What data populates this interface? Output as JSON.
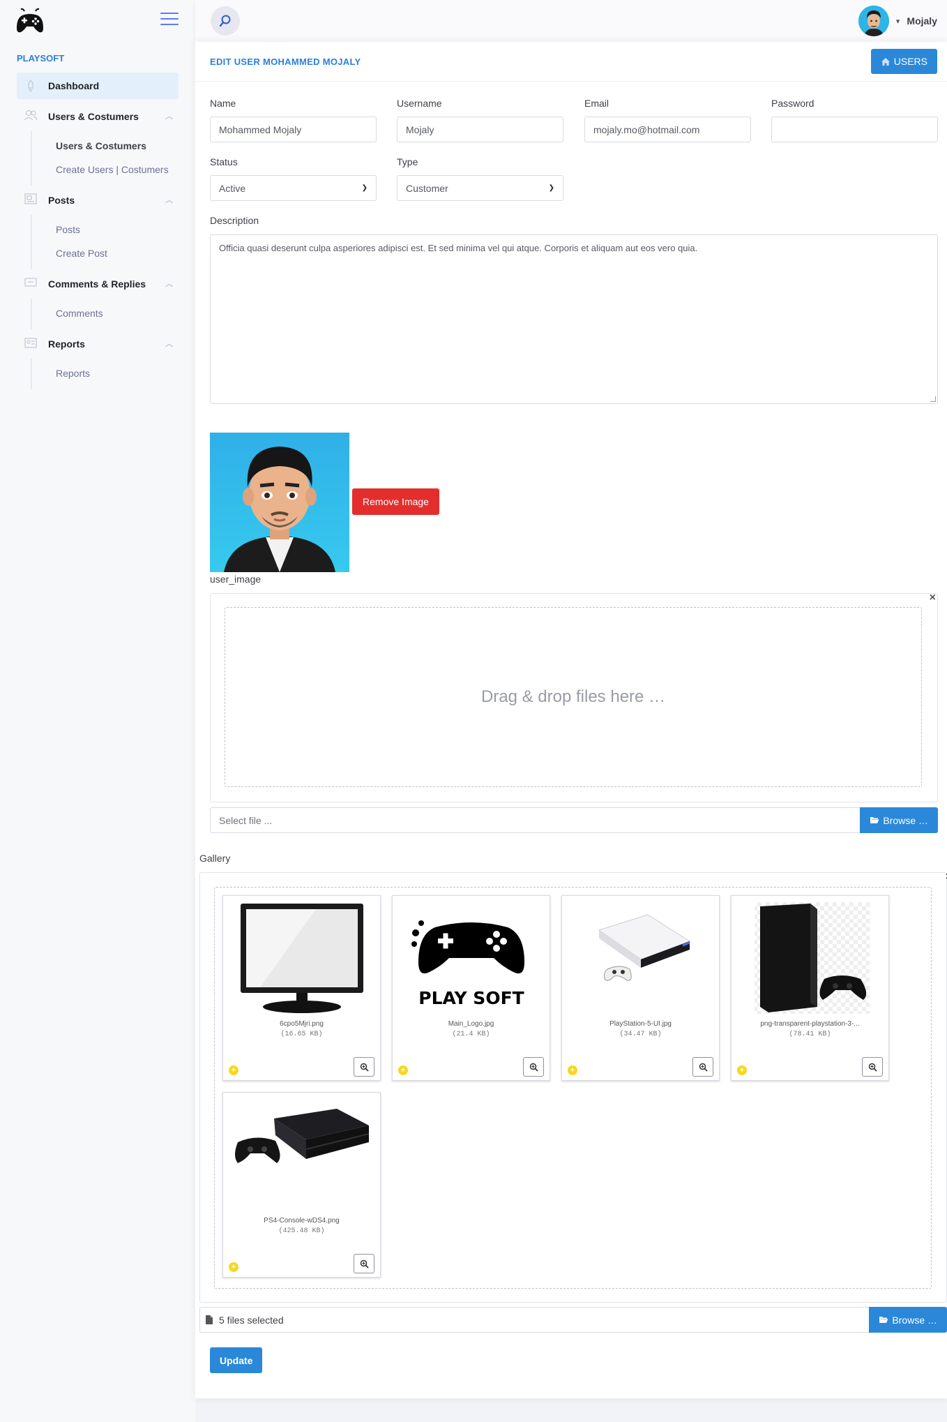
{
  "brand": "PLAYSOFT",
  "sidebar": {
    "items": [
      {
        "label": "Dashboard"
      },
      {
        "label": "Users & Costumers",
        "sub": [
          "Users & Costumers",
          "Create Users | Costumers"
        ]
      },
      {
        "label": "Posts",
        "sub": [
          "Posts",
          "Create Post"
        ]
      },
      {
        "label": "Comments & Replies",
        "sub": [
          "Comments"
        ]
      },
      {
        "label": "Reports",
        "sub": [
          "Reports"
        ]
      }
    ]
  },
  "topbar": {
    "user_name": "Mojaly"
  },
  "page": {
    "title": "EDIT USER MOHAMMED MOJALY",
    "users_button": "USERS",
    "labels": {
      "name": "Name",
      "username": "Username",
      "email": "Email",
      "password": "Password",
      "status": "Status",
      "type": "Type",
      "description": "Description"
    },
    "fields": {
      "name": "Mohammed Mojaly",
      "username": "Mojaly",
      "email": "mojaly.mo@hotmail.com",
      "password": "",
      "status": "Active",
      "type": "Customer",
      "description": "Officia quasi deserunt culpa asperiores adipisci est. Et sed minima vel qui atque. Corporis et aliquam aut eos vero quia."
    },
    "remove_image": "Remove Image",
    "image_label": "user_image",
    "drop_text": "Drag & drop files here …",
    "select_file_placeholder": "Select file ...",
    "browse": "Browse …",
    "gallery_label": "Gallery",
    "gallery_files": [
      {
        "name": "6cpo5Mjri.png",
        "size": "(16.65 KB)"
      },
      {
        "name": "Main_Logo.jpg",
        "size": "(21.4 KB)"
      },
      {
        "name": "PlayStation-5-UI.jpg",
        "size": "(34.47 KB)"
      },
      {
        "name": "png-transparent-playstation-3-...",
        "size": "(78.41 KB)"
      },
      {
        "name": "PS4-Console-wDS4.png",
        "size": "(425.48 KB)"
      }
    ],
    "gallery_logo_text": "PLAY SOFT",
    "files_selected": "5 files selected",
    "update": "Update"
  },
  "colors": {
    "accent": "#2b88d9",
    "danger": "#e42e2e",
    "brand": "#2b7fdb"
  }
}
